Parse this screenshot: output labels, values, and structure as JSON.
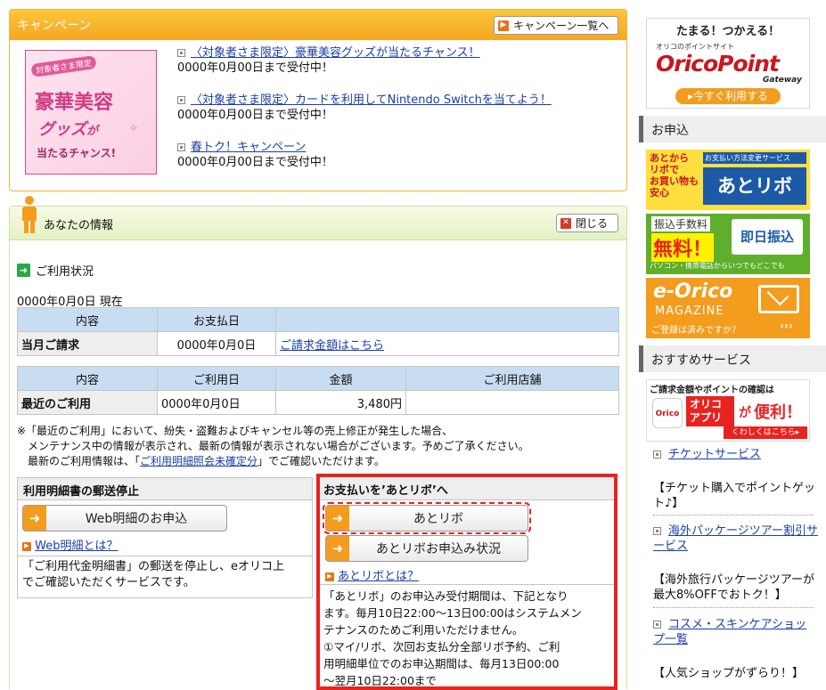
{
  "campaign": {
    "title": "キャンペーン",
    "list_button": "キャンペーン一覧へ",
    "promo": {
      "badge": "対象者さま限定",
      "line1": "豪華美容",
      "line2": "グッズ",
      "line2b": "が",
      "line3": "当たるチャンス!"
    },
    "items": [
      {
        "link": "〈対象者さま限定〉豪華美容グッズが当たるチャンス！",
        "note": "0000年0月00日まで受付中！"
      },
      {
        "link": "〈対象者さま限定〉カードを利用してNintendo Switchを当てよう！",
        "note": "0000年0月00日まで受付中！"
      },
      {
        "link": "春トク！キャンペーン",
        "note": "0000年0月00日まで受付中！"
      }
    ]
  },
  "info": {
    "title": "あなたの情報",
    "close_button": "閉じる",
    "usage_heading": "ご利用状況",
    "as_of": "0000年0月0日 現在",
    "billing_table": {
      "headers": [
        "内容",
        "お支払日",
        ""
      ],
      "row": {
        "label": "当月ご請求",
        "date": "0000年0月0日",
        "link": "ご請求金額はこちら"
      }
    },
    "recent_table": {
      "headers": [
        "内容",
        "ご利用日",
        "金額",
        "ご利用店舗"
      ],
      "row": {
        "label": "最近のご利用",
        "date": "0000年0月0日",
        "amount": "3,480円",
        "shop": ""
      }
    },
    "notes": {
      "line1": "※「最近のご利用」において、紛失・盗難およびキャンセル等の売上修正が発生した場合、",
      "line2": "メンテナンス中の情報が表示され、最新の情報が表示されない場合がございます。予めご了承ください。",
      "line3_pre": "最新のご利用情報は、「",
      "line3_link": "ご利用明細照会未確定分",
      "line3_post": "」でご確認いただけます。"
    },
    "mail_stop": {
      "heading": "利用明細書の郵送停止",
      "button": "Web明細のお申込",
      "link": "Web明細とは？",
      "text_line1": "「ご利用代金明細書」の郵送を停止し、eオリコ上",
      "text_line2": "でご確認いただくサービスです。"
    },
    "atoribo": {
      "heading": "お支払いを’あとリボ’へ",
      "button1": "あとリボ",
      "button2": "あとリボお申込み状況",
      "link": "あとリボとは？",
      "text": [
        "「あとリボ」のお申込み受付期間は、下記となり",
        "ます。毎月10日22:00～13日00:00はシステムメン",
        "テナンスのためご利用いただけません。",
        "①マイ/リボ、次回お支払分全部リボ予約、ご利",
        "用明細単位でのお申込期間は、毎月13日00:00",
        "～翌月10日22:00まで"
      ]
    }
  },
  "sidebar": {
    "point_banner": {
      "top": "たまる！つかえる！",
      "small": "オリコのポイントサイト",
      "logo": "OricoPoint",
      "sub": "Gateway",
      "cta": "▸今すぐ利用する"
    },
    "apply_heading": "お申込",
    "banner_atoribo": {
      "left1": "あとから",
      "left2": "リボで",
      "left3": "お買い物も",
      "left4": "安心",
      "top": "お支払い方法変更サービス",
      "main": "あとリボ"
    },
    "banner_furikomi": {
      "title": "振込手数料",
      "big": "無料！",
      "badge": "即日振込",
      "small": "パソコン・携帯電話からいつでもどこでも"
    },
    "banner_magazine": {
      "logo": "e-Orico",
      "sub": "MAGAZINE",
      "small": "ご登録は済みですか？"
    },
    "recommend_heading": "おすすめサービス",
    "banner_app": {
      "top": "ご請求金額やポイントの確認は",
      "brand": "Orico",
      "word1": "オリコ",
      "word2": "アプリ",
      "ga": "が",
      "benri": "便利！",
      "more": "くわしくはこちら▸"
    },
    "links": [
      {
        "link": "チケットサービス",
        "desc": "【チケット購入でポイントゲット♪】"
      },
      {
        "link": "海外パッケージツアー割引サービス",
        "desc": "【海外旅行パッケージツアーが最大8%OFFでおトク！】"
      },
      {
        "link": "コスメ・スキンケアショップ一覧",
        "desc": "【人気ショップがずらり！】"
      }
    ]
  },
  "colors": {
    "campaign_header": "#f5a623",
    "info_header": "#e4f1c3",
    "table_header": "#c9ddf2",
    "highlight_red": "#e8231f",
    "arrow_orange": "#f39c1e",
    "link": "#1a3fa8"
  }
}
